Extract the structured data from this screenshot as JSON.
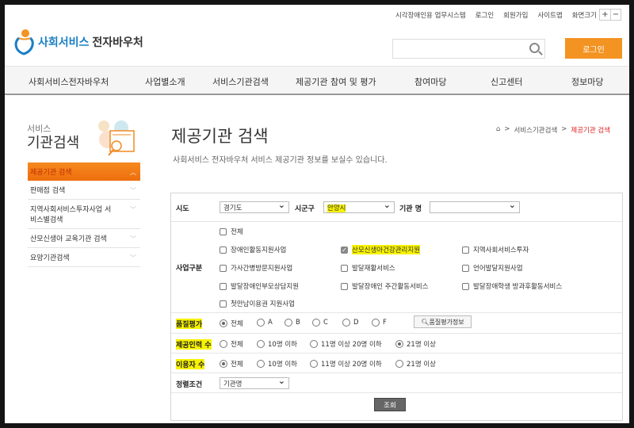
{
  "util": {
    "links": [
      "시각장애인용 업무시스템",
      "로그인",
      "회원가입",
      "사이트맵"
    ],
    "font_size_label": "화면크기",
    "plus": "+",
    "minus": "−"
  },
  "logo": {
    "part1": "사회서비스",
    "part2": "전자바우처"
  },
  "header": {
    "login": "로그인",
    "search_placeholder": ""
  },
  "nav": [
    "사회서비스전자바우처",
    "사업별소개",
    "서비스기관검색",
    "제공기관 참여 및 평가",
    "참여마당",
    "신고센터",
    "정보마당"
  ],
  "sidebar": {
    "title_small": "서비스",
    "title": "기관검색",
    "items": [
      {
        "label": "제공기관 검색",
        "active": true
      },
      {
        "label": "판매점 검색"
      },
      {
        "label": "지역사회서비스투자사업 서비스별검색"
      },
      {
        "label": "산모신생아 교육기관 검색"
      },
      {
        "label": "요양기관검색"
      }
    ]
  },
  "page": {
    "title": "제공기관 검색",
    "subtitle": "사회서비스 전자바우처 서비스 제공기관 정보를 보실수 있습니다.",
    "breadcrumb": [
      "서비스기관검색",
      "제공기관 검색"
    ]
  },
  "form": {
    "sido_label": "시도",
    "sido_value": "경기도",
    "sigungu_label": "시군구",
    "sigungu_value": "안양시",
    "name_label": "기관 명",
    "name_value": "",
    "biz_label": "사업구분",
    "biz_all": "전체",
    "biz_items": [
      {
        "label": "장애인활동지원사업",
        "checked": false
      },
      {
        "label": "산모신생아건강관리지원",
        "checked": true
      },
      {
        "label": "지역사회서비스투자",
        "checked": false
      },
      {
        "label": "가사간병방문지원사업",
        "checked": false
      },
      {
        "label": "발달재활서비스",
        "checked": false
      },
      {
        "label": "언어발달지원사업",
        "checked": false
      },
      {
        "label": "발달장애인부모상담지원",
        "checked": false
      },
      {
        "label": "발달장애인 주간활동서비스",
        "checked": false
      },
      {
        "label": "발달장애학생 방과후활동서비스",
        "checked": false
      },
      {
        "label": "첫만남이용권 지원사업",
        "checked": false
      }
    ],
    "quality_label": "품질평가",
    "quality_options": [
      "전체",
      "A",
      "B",
      "C",
      "D",
      "F"
    ],
    "quality_selected": "전체",
    "quality_info": "품질평가정보",
    "staff_label": "제공인력 수",
    "staff_options": [
      "전체",
      "10명 이하",
      "11명 이상 20명 이하",
      "21명 이상"
    ],
    "staff_selected": "21명 이상",
    "users_label": "이용자 수",
    "users_options": [
      "전체",
      "10명 이하",
      "11명 이상 20명 이하",
      "21명 이상"
    ],
    "users_selected": "전체",
    "sort_label": "정렬조건",
    "sort_value": "기관명",
    "submit": "조회"
  }
}
